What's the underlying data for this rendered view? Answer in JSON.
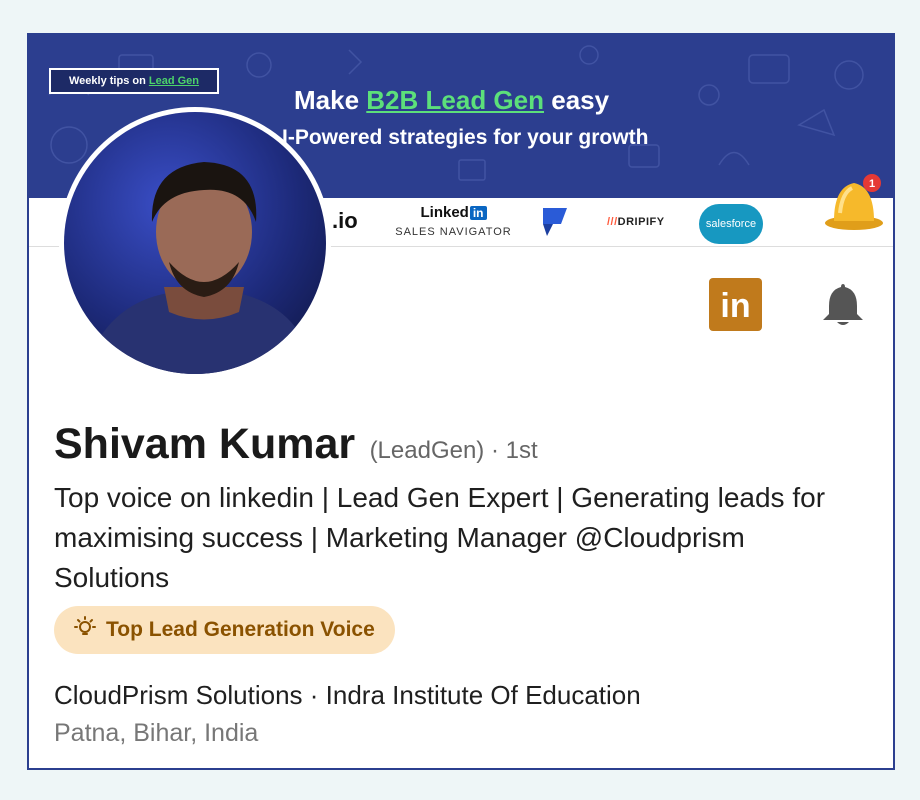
{
  "banner": {
    "tips_prefix": "Weekly tips on",
    "tips_link": "Lead Gen",
    "headline_prefix": "Make",
    "headline_highlight": "B2B Lead Gen",
    "headline_suffix": "easy",
    "subheadline": "I-Powered strategies for your growth",
    "bell_count": "1",
    "logos": {
      "io": ".io",
      "linkedin_word": "Linked",
      "linkedin_box": "in",
      "linkedin_sub": "SALES NAVIGATOR",
      "dripify_slash": "///",
      "dripify_word": "DRIPIFY",
      "salesforce": "salesforce"
    }
  },
  "actions": {
    "linkedin_icon": "in",
    "bell_icon": "bell-icon"
  },
  "profile": {
    "name": "Shivam Kumar",
    "pronunciation": "(LeadGen)",
    "connection_degree": " · 1st",
    "headline": "Top voice on linkedin | Lead Gen Expert | Generating leads for maximising success | Marketing Manager @Cloudprism Solutions",
    "badge": "Top Lead Generation Voice",
    "organizations": "CloudPrism Solutions · Indra Institute Of Education",
    "location": "Patna, Bihar, India"
  },
  "colors": {
    "banner": "#2c3e8f",
    "accent_green": "#5ce07a",
    "badge_bg": "#fbe3bf",
    "badge_text": "#8a5200",
    "linkedin_button": "#c07a1c",
    "frame_border": "#2b3f8f"
  }
}
